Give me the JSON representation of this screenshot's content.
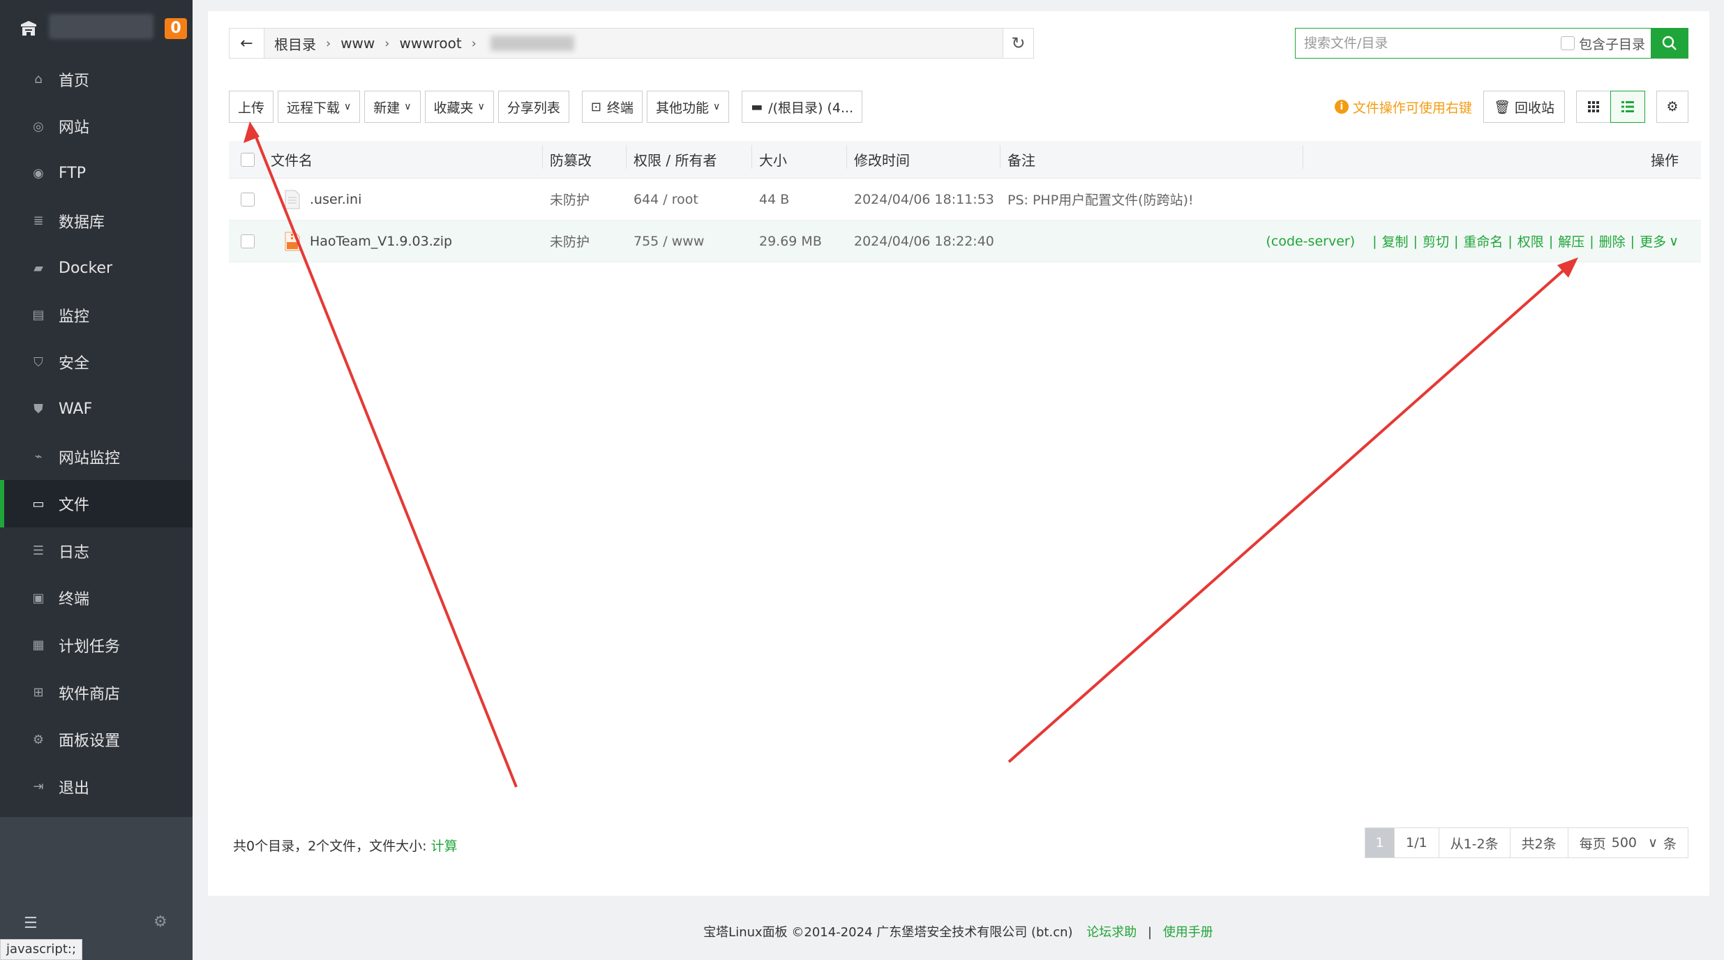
{
  "sidebar": {
    "notice_count": "0",
    "items": [
      {
        "label": "首页",
        "icon": "home-icon"
      },
      {
        "label": "网站",
        "icon": "globe-icon"
      },
      {
        "label": "FTP",
        "icon": "ftp-icon"
      },
      {
        "label": "数据库",
        "icon": "database-icon"
      },
      {
        "label": "Docker",
        "icon": "docker-icon"
      },
      {
        "label": "监控",
        "icon": "monitor-icon"
      },
      {
        "label": "安全",
        "icon": "shield-icon"
      },
      {
        "label": "WAF",
        "icon": "waf-icon"
      },
      {
        "label": "网站监控",
        "icon": "chart-icon"
      },
      {
        "label": "文件",
        "icon": "folder-icon",
        "active": true
      },
      {
        "label": "日志",
        "icon": "log-icon"
      },
      {
        "label": "终端",
        "icon": "terminal-icon"
      },
      {
        "label": "计划任务",
        "icon": "calendar-icon"
      },
      {
        "label": "软件商店",
        "icon": "apps-icon"
      },
      {
        "label": "面板设置",
        "icon": "gear-icon"
      },
      {
        "label": "退出",
        "icon": "logout-icon"
      }
    ],
    "status_url": "javascript:;"
  },
  "path": {
    "crumbs": [
      "根目录",
      "www",
      "wwwroot"
    ]
  },
  "search": {
    "placeholder": "搜索文件/目录",
    "include_sub_label": "包含子目录"
  },
  "toolbar": {
    "upload": "上传",
    "remote_download": "远程下载",
    "new": "新建",
    "favorites": "收藏夹",
    "share_list": "分享列表",
    "terminal": "终端",
    "other": "其他功能",
    "disk": "/(根目录) (4..."
  },
  "right_tools": {
    "tip": "文件操作可使用右键",
    "recycle": "回收站"
  },
  "table": {
    "headers": {
      "name": "文件名",
      "protect": "防篡改",
      "perm": "权限 / 所有者",
      "size": "大小",
      "mtime": "修改时间",
      "note": "备注",
      "ops": "操作"
    },
    "rows": [
      {
        "name": ".user.ini",
        "protect": "未防护",
        "perm": "644 / root",
        "size": "44 B",
        "mtime": "2024/04/06 18:11:53",
        "note": "PS: PHP用户配置文件(防跨站)!"
      },
      {
        "name": "HaoTeam_V1.9.03.zip",
        "protect": "未防护",
        "perm": "755 / www",
        "size": "29.69 MB",
        "mtime": "2024/04/06 18:22:40",
        "note": ""
      }
    ],
    "row_ops": {
      "server": "(code-server)",
      "copy": "复制",
      "cut": "剪切",
      "rename": "重命名",
      "perm": "权限",
      "unzip": "解压",
      "delete": "删除",
      "more": "更多"
    }
  },
  "footer": {
    "summary": "共0个目录，2个文件，文件大小: ",
    "calc": "计算"
  },
  "pager": {
    "current": "1",
    "pages": "1/1",
    "range": "从1-2条",
    "total": "共2条",
    "per_page_label": "每页",
    "per_page": "500",
    "unit": "条"
  },
  "copyright": {
    "text": "宝塔Linux面板 ©2014-2024 广东堡塔安全技术有限公司 (bt.cn)",
    "forum": "论坛求助",
    "sep": "|",
    "manual": "使用手册"
  },
  "colors": {
    "accent": "#20a53a",
    "sidebar_bg": "#2c3138",
    "arrow": "#e53935",
    "tip": "#f39c12"
  }
}
